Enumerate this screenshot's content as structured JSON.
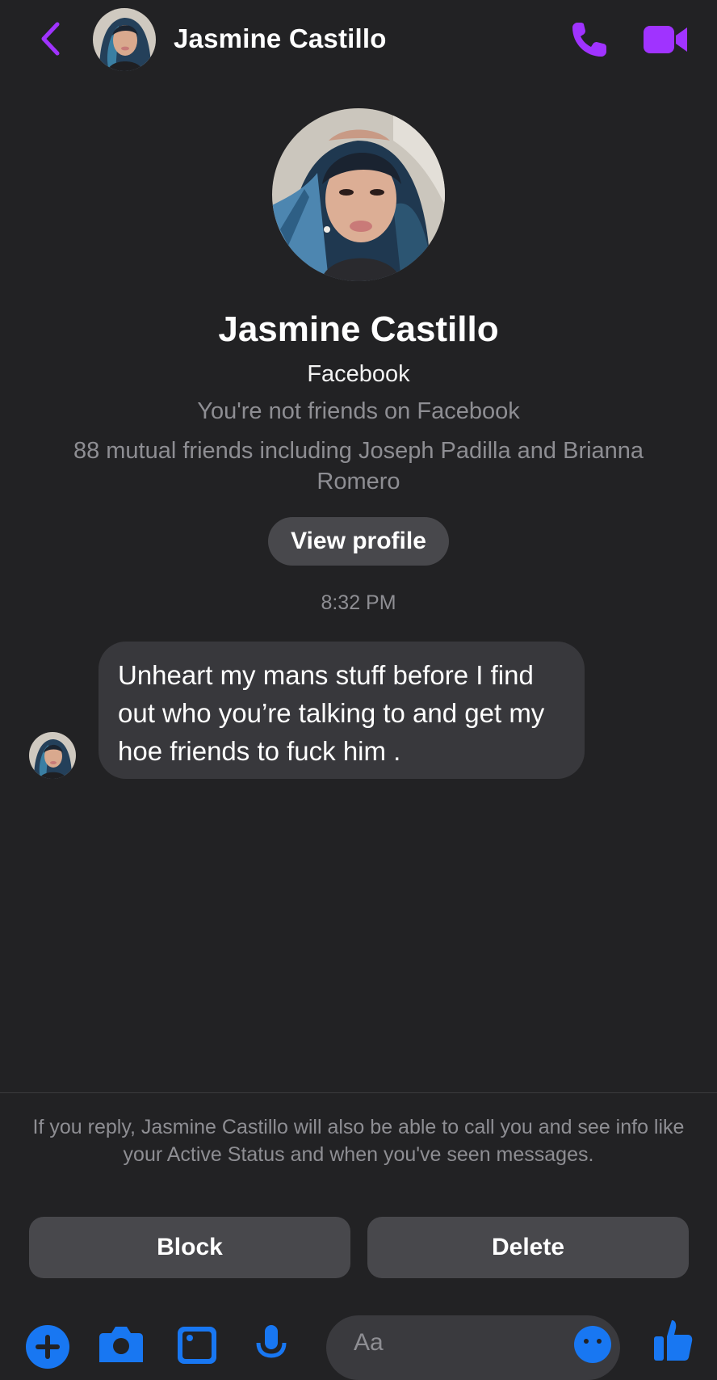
{
  "header": {
    "contact_name": "Jasmine Castillo"
  },
  "profile": {
    "name": "Jasmine Castillo",
    "source": "Facebook",
    "friend_status": "You're not friends on Facebook",
    "mutual_friends": "88 mutual friends including Joseph Padilla and Brianna Romero",
    "view_profile_label": "View profile"
  },
  "conversation": {
    "timestamp": "8:32 PM",
    "messages": [
      {
        "sender": "Jasmine Castillo",
        "text": "Unheart my mans stuff before I find out who you’re talking to and get my hoe friends to fuck him ."
      }
    ]
  },
  "request_notice": {
    "text": "If you reply, Jasmine Castillo will also be able to call you and see info like your Active Status and when you've seen messages.",
    "block_label": "Block",
    "delete_label": "Delete"
  },
  "composer": {
    "placeholder": "Aa",
    "icons": [
      "plus-icon",
      "camera-icon",
      "image-icon",
      "microphone-icon",
      "emoji-icon",
      "thumbs-up-icon"
    ]
  },
  "colors": {
    "accent": "#a033ff",
    "composer_accent": "#1877f2",
    "background": "#222224",
    "bubble": "#38383c",
    "button": "#48484c",
    "secondary_text": "#8e8e93"
  }
}
